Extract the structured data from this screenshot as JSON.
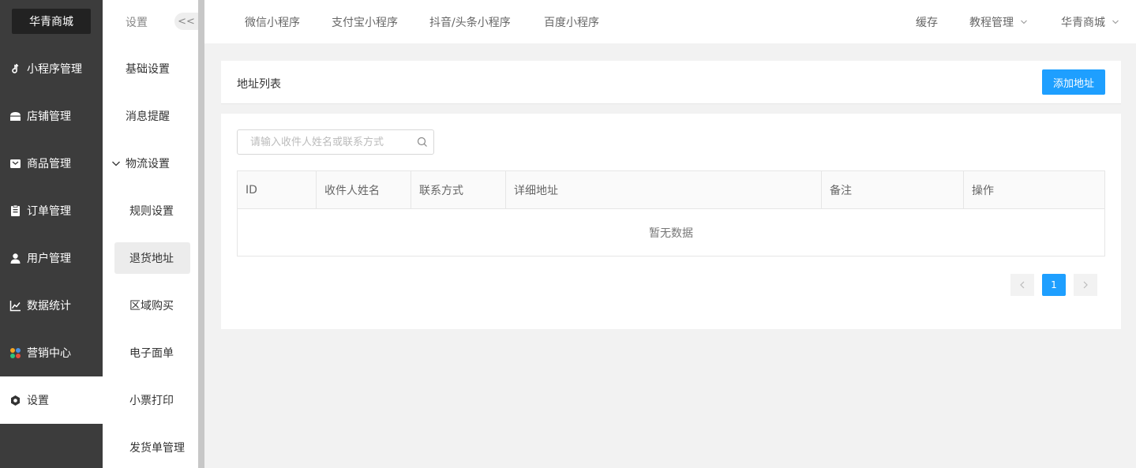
{
  "brand": "华青商城",
  "sidebar": {
    "items": [
      {
        "label": "小程序管理",
        "icon": "music-note-icon"
      },
      {
        "label": "店铺管理",
        "icon": "store-icon"
      },
      {
        "label": "商品管理",
        "icon": "product-box-icon"
      },
      {
        "label": "订单管理",
        "icon": "clipboard-icon"
      },
      {
        "label": "用户管理",
        "icon": "user-icon"
      },
      {
        "label": "数据统计",
        "icon": "line-chart-icon"
      },
      {
        "label": "营销中心",
        "icon": "marketing-icon"
      },
      {
        "label": "设置",
        "icon": "gear-icon",
        "active": true
      }
    ]
  },
  "subbar": {
    "title": "设置",
    "collapse_label": "<<",
    "items": [
      {
        "label": "基础设置"
      },
      {
        "label": "消息提醒"
      },
      {
        "label": "物流设置"
      },
      {
        "label": "规则设置"
      },
      {
        "label": "退货地址",
        "active": true
      },
      {
        "label": "区域购买"
      },
      {
        "label": "电子面单"
      },
      {
        "label": "小票打印"
      },
      {
        "label": "发货单管理"
      }
    ]
  },
  "topbar": {
    "tabs": [
      "微信小程序",
      "支付宝小程序",
      "抖音/头条小程序",
      "百度小程序"
    ],
    "cache": "缓存",
    "tutorial": "教程管理",
    "store": "华青商城"
  },
  "main": {
    "title": "地址列表",
    "add_button": "添加地址",
    "search_placeholder": "请输入收件人姓名或联系方式",
    "columns": [
      "ID",
      "收件人姓名",
      "联系方式",
      "详细地址",
      "备注",
      "操作"
    ],
    "empty_text": "暂无数据",
    "pagination": {
      "current": "1"
    }
  },
  "colors": {
    "accent": "#1e9fff",
    "sidebar": "#3c3c3c"
  }
}
